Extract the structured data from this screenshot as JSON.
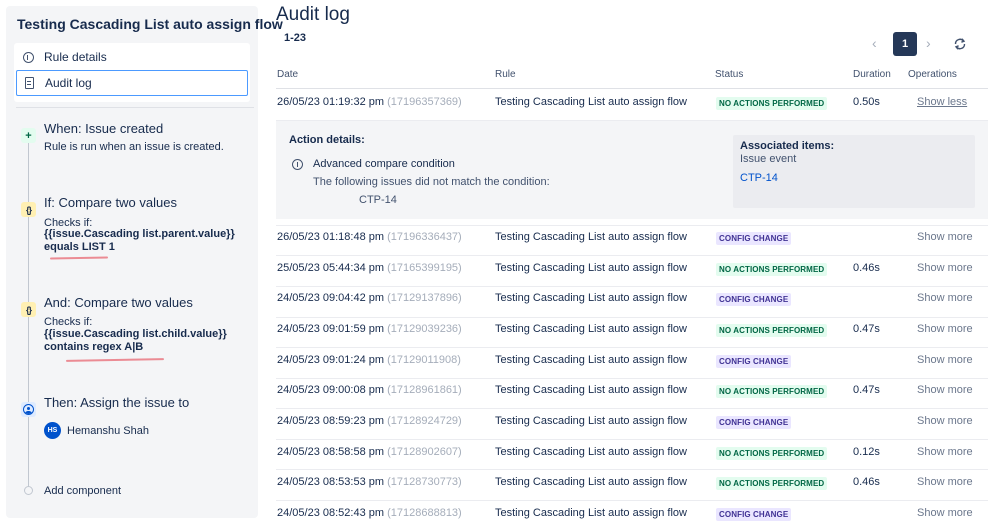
{
  "sidebar": {
    "rule_title": "Testing Cascading List auto assign flow",
    "menu": {
      "rule_details": "Rule details",
      "audit_log": "Audit log"
    },
    "components": {
      "trigger": {
        "title": "When: Issue created",
        "subtitle": "Rule is run when an issue is created."
      },
      "condition1": {
        "title": "If: Compare two values",
        "checks_label": "Checks if:",
        "line1": "{{issue.Cascading list.parent.value}}",
        "line2": "equals LIST 1"
      },
      "condition2": {
        "title": "And: Compare two values",
        "checks_label": "Checks if:",
        "line1": "{{issue.Cascading list.child.value}}",
        "line2": "contains regex A|B"
      },
      "action": {
        "title": "Then: Assign the issue to",
        "assignee_initials": "HS",
        "assignee_name": "Hemanshu Shah"
      },
      "add_component": "Add component"
    }
  },
  "audit": {
    "title": "Audit log",
    "range": "1-23",
    "pagination": {
      "prev": "‹",
      "current_page": "1",
      "next": "›"
    },
    "columns": {
      "date": "Date",
      "rule": "Rule",
      "status": "Status",
      "duration": "Duration",
      "operations": "Operations"
    },
    "expanded": {
      "action_details_label": "Action details:",
      "condition_name": "Advanced compare condition",
      "condition_desc": "The following issues did not match the condition:",
      "issue_key": "CTP-14",
      "associated_title": "Associated items:",
      "associated_type": "Issue event",
      "associated_link": "CTP-14"
    },
    "rows": [
      {
        "date": "26/05/23 01:19:32 pm",
        "id": "(17196357369)",
        "rule": "Testing Cascading List auto assign flow",
        "status": "NO ACTIONS PERFORMED",
        "duration": "0.50s",
        "op": "Show less"
      },
      {
        "date": "26/05/23 01:18:48 pm",
        "id": "(17196336437)",
        "rule": "Testing Cascading List auto assign flow",
        "status": "CONFIG CHANGE",
        "duration": "",
        "op": "Show more"
      },
      {
        "date": "25/05/23 05:44:34 pm",
        "id": "(17165399195)",
        "rule": "Testing Cascading List auto assign flow",
        "status": "NO ACTIONS PERFORMED",
        "duration": "0.46s",
        "op": "Show more"
      },
      {
        "date": "24/05/23 09:04:42 pm",
        "id": "(17129137896)",
        "rule": "Testing Cascading List auto assign flow",
        "status": "CONFIG CHANGE",
        "duration": "",
        "op": "Show more"
      },
      {
        "date": "24/05/23 09:01:59 pm",
        "id": "(17129039236)",
        "rule": "Testing Cascading List auto assign flow",
        "status": "NO ACTIONS PERFORMED",
        "duration": "0.47s",
        "op": "Show more"
      },
      {
        "date": "24/05/23 09:01:24 pm",
        "id": "(17129011908)",
        "rule": "Testing Cascading List auto assign flow",
        "status": "CONFIG CHANGE",
        "duration": "",
        "op": "Show more"
      },
      {
        "date": "24/05/23 09:00:08 pm",
        "id": "(17128961861)",
        "rule": "Testing Cascading List auto assign flow",
        "status": "NO ACTIONS PERFORMED",
        "duration": "0.47s",
        "op": "Show more"
      },
      {
        "date": "24/05/23 08:59:23 pm",
        "id": "(17128924729)",
        "rule": "Testing Cascading List auto assign flow",
        "status": "CONFIG CHANGE",
        "duration": "",
        "op": "Show more"
      },
      {
        "date": "24/05/23 08:58:58 pm",
        "id": "(17128902607)",
        "rule": "Testing Cascading List auto assign flow",
        "status": "NO ACTIONS PERFORMED",
        "duration": "0.12s",
        "op": "Show more"
      },
      {
        "date": "24/05/23 08:53:53 pm",
        "id": "(17128730773)",
        "rule": "Testing Cascading List auto assign flow",
        "status": "NO ACTIONS PERFORMED",
        "duration": "0.46s",
        "op": "Show more"
      },
      {
        "date": "24/05/23 08:52:43 pm",
        "id": "(17128688813)",
        "rule": "Testing Cascading List auto assign flow",
        "status": "CONFIG CHANGE",
        "duration": "",
        "op": "Show more"
      }
    ]
  }
}
